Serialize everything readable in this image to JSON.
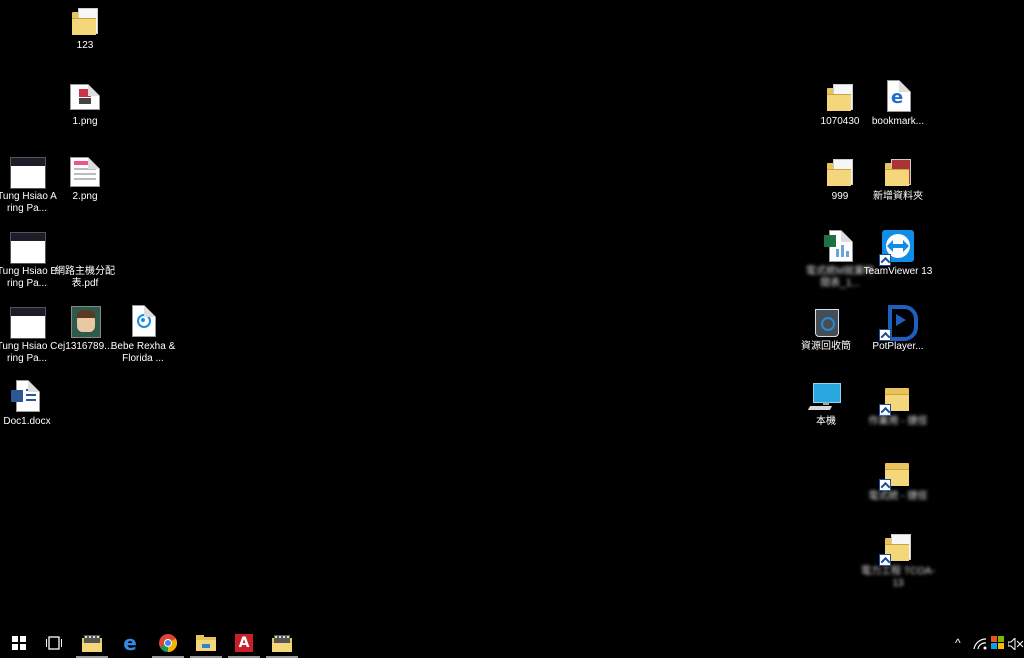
{
  "desktop": {
    "left": [
      {
        "label": "123",
        "kind": "folder"
      },
      {
        "label": "1.png",
        "kind": "image"
      },
      {
        "label": "2.png",
        "kind": "image"
      },
      {
        "label": "Tung Hsiao A ring Pa...",
        "kind": "screenshot"
      },
      {
        "label": "Tung Hsiao B ring Pa...",
        "kind": "screenshot"
      },
      {
        "label": "網路主機分配表.pdf",
        "kind": "pdf"
      },
      {
        "label": "Tung Hsiao C ring Pa...",
        "kind": "screenshot"
      },
      {
        "label": "ej1316789...",
        "kind": "photo"
      },
      {
        "label": "Bebe Rexha & Florida ...",
        "kind": "media"
      },
      {
        "label": "Doc1.docx",
        "kind": "word"
      }
    ],
    "right": [
      {
        "label": "1070430",
        "kind": "folder"
      },
      {
        "label": "bookmark...",
        "kind": "edge-file"
      },
      {
        "label": "999",
        "kind": "folder"
      },
      {
        "label": "新增資料夾",
        "kind": "folder"
      },
      {
        "label": "電式統M就業時間表_1...",
        "kind": "excel",
        "blurred": true
      },
      {
        "label": "TeamViewer 13",
        "kind": "teamviewer"
      },
      {
        "label": "資源回收筒",
        "kind": "recycle"
      },
      {
        "label": "PotPlayer...",
        "kind": "potplayer"
      },
      {
        "label": "本機",
        "kind": "computer"
      },
      {
        "label": "作業用 - 捷徑",
        "kind": "folder-shortcut",
        "blurred": true
      },
      {
        "label": "電式統 - 捷徑",
        "kind": "folder-shortcut",
        "blurred": true
      },
      {
        "label": "電力工程 TCOA-13",
        "kind": "folder-shortcut",
        "blurred": true
      }
    ]
  },
  "taskbar": {
    "start": "start-icon",
    "apps": [
      "task-view-icon",
      "film-folder-icon",
      "edge-icon",
      "chrome-icon",
      "file-explorer-icon",
      "acrobat-icon",
      "film-folder-icon"
    ],
    "tray": {
      "chevron": "^",
      "wifi": "wifi-icon",
      "flag": "security-flag-icon",
      "volume": "volume-muted-icon"
    }
  },
  "colors": {
    "background": "#000000",
    "folder": "#f4d77a",
    "edge_blue": "#1f6fd0",
    "teamviewer": "#0e8ee9",
    "potplayer": "#1f5fbf"
  }
}
